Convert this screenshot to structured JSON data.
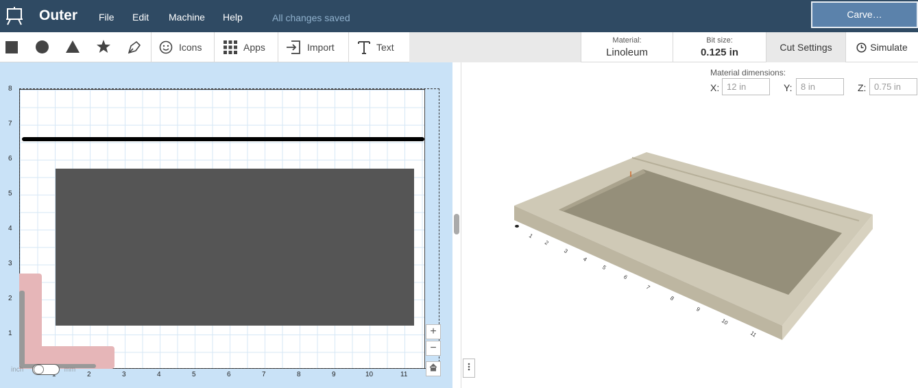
{
  "app": {
    "title": "Outer",
    "status": "All changes saved"
  },
  "menu": {
    "file": "File",
    "edit": "Edit",
    "machine": "Machine",
    "help": "Help"
  },
  "carve_label": "Carve…",
  "tools": {
    "icons": "Icons",
    "apps": "Apps",
    "import": "Import",
    "text": "Text"
  },
  "material": {
    "caption": "Material:",
    "value": "Linoleum"
  },
  "bit": {
    "caption": "Bit size:",
    "value": "0.125 in"
  },
  "cut_settings": "Cut Settings",
  "simulate": "Simulate",
  "dimensions": {
    "caption": "Material dimensions:",
    "x_label": "X:",
    "x_value": "12 in",
    "y_label": "Y:",
    "y_value": "8 in",
    "z_label": "Z:",
    "z_value": "0.75 in"
  },
  "canvas": {
    "y_ticks": [
      "8",
      "7",
      "6",
      "5",
      "4",
      "3",
      "2",
      "1"
    ],
    "x_ticks": [
      "1",
      "2",
      "3",
      "4",
      "5",
      "6",
      "7",
      "8",
      "9",
      "10",
      "11"
    ],
    "unit_in": "inch",
    "unit_mm": "mm"
  },
  "zoom": {
    "in": "+",
    "out": "−"
  },
  "preview_ticks": [
    "1",
    "2",
    "3",
    "4",
    "5",
    "6",
    "7",
    "8",
    "9",
    "10",
    "11"
  ],
  "colors": {
    "topbar": "#2f4a63",
    "carve": "#5b82ab",
    "shape": "#555555",
    "material": "#c9c3b0"
  },
  "icons": [
    "easel-icon",
    "square-icon",
    "circle-icon",
    "triangle-icon",
    "star-icon",
    "pen-icon",
    "smiley-icon",
    "grid-icon",
    "import-icon",
    "text-icon",
    "clock-icon",
    "home-icon",
    "dots-icon"
  ]
}
